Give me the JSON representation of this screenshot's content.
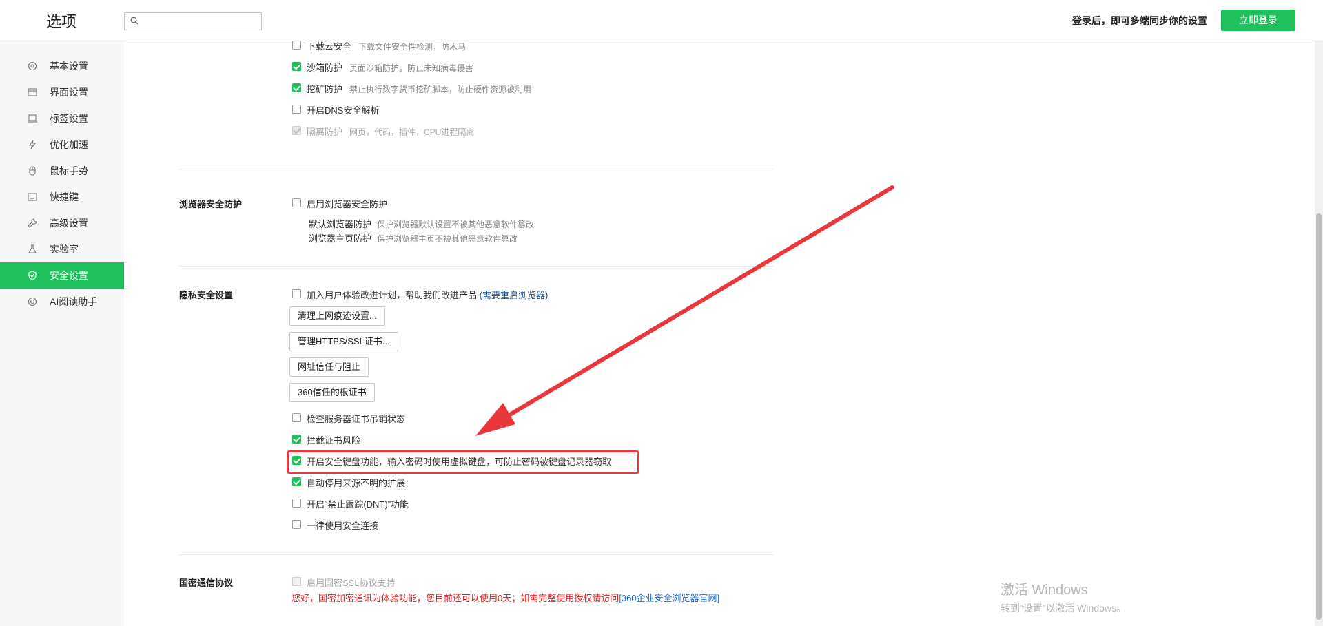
{
  "header": {
    "title": "选项",
    "search_placeholder": "",
    "login_tip": "登录后，即可多端同步你的设置",
    "login_button": "立即登录"
  },
  "sidebar": {
    "items": [
      {
        "label": "基本设置",
        "icon": "settings-icon"
      },
      {
        "label": "界面设置",
        "icon": "window-icon"
      },
      {
        "label": "标签设置",
        "icon": "tab-icon"
      },
      {
        "label": "优化加速",
        "icon": "lightning-icon"
      },
      {
        "label": "鼠标手势",
        "icon": "mouse-icon"
      },
      {
        "label": "快捷键",
        "icon": "keyboard-icon"
      },
      {
        "label": "高级设置",
        "icon": "wrench-icon"
      },
      {
        "label": "实验室",
        "icon": "flask-icon"
      },
      {
        "label": "安全设置",
        "icon": "shield-icon",
        "active": true
      },
      {
        "label": "AI阅读助手",
        "icon": "ai-icon"
      }
    ]
  },
  "top_section": {
    "items": [
      {
        "label": "下载云安全",
        "desc": "下载文件安全性检测，防木马",
        "checked": false
      },
      {
        "label": "沙箱防护",
        "desc": "页面沙箱防护，防止未知病毒侵害",
        "checked": true
      },
      {
        "label": "挖矿防护",
        "desc": "禁止执行数字货币挖矿脚本，防止硬件资源被利用",
        "checked": true
      },
      {
        "label": "开启DNS安全解析",
        "desc": "",
        "checked": false
      },
      {
        "label": "隔离防护",
        "desc": "网页，代码，插件，CPU进程隔离",
        "checked": true,
        "disabled": true
      }
    ]
  },
  "browser_protection": {
    "title": "浏览器安全防护",
    "enable_label": "启用浏览器安全防护",
    "sub": [
      {
        "label": "默认浏览器防护",
        "desc": "保护浏览器默认设置不被其他恶意软件篡改"
      },
      {
        "label": "浏览器主页防护",
        "desc": "保护浏览器主页不被其他恶意软件篡改"
      }
    ]
  },
  "privacy": {
    "title": "隐私安全设置",
    "join_label": "加入用户体验改进计划，帮助我们改进产品",
    "join_link": "(需要重启浏览器)",
    "buttons": [
      "清理上网痕迹设置...",
      "管理HTTPS/SSL证书...",
      "网址信任与阻止",
      "360信任的根证书"
    ],
    "items": [
      {
        "label": "检查服务器证书吊销状态",
        "checked": false
      },
      {
        "label": "拦截证书风险",
        "checked": true
      },
      {
        "label": "开启安全键盘功能，输入密码时使用虚拟键盘，可防止密码被键盘记录器窃取",
        "checked": true
      },
      {
        "label": "自动停用来源不明的扩展",
        "checked": true
      },
      {
        "label": "开启“禁止跟踪(DNT)”功能",
        "checked": false
      },
      {
        "label": "一律使用安全连接",
        "checked": false
      }
    ]
  },
  "national_crypto": {
    "title": "国密通信协议",
    "enable_label": "启用国密SSL协议支持",
    "warning": "您好，国密加密通讯为体验功能，您目前还可以使用0天；如需完整使用授权请访问",
    "warning_link": "[360企业安全浏览器官网]"
  },
  "watermark": {
    "line1": "激活 Windows",
    "line2": "转到“设置”以激活 Windows。"
  },
  "colors": {
    "accent": "#20c05c",
    "highlight": "#e8383d",
    "link": "#1a6fd6",
    "warning": "#e02020"
  }
}
